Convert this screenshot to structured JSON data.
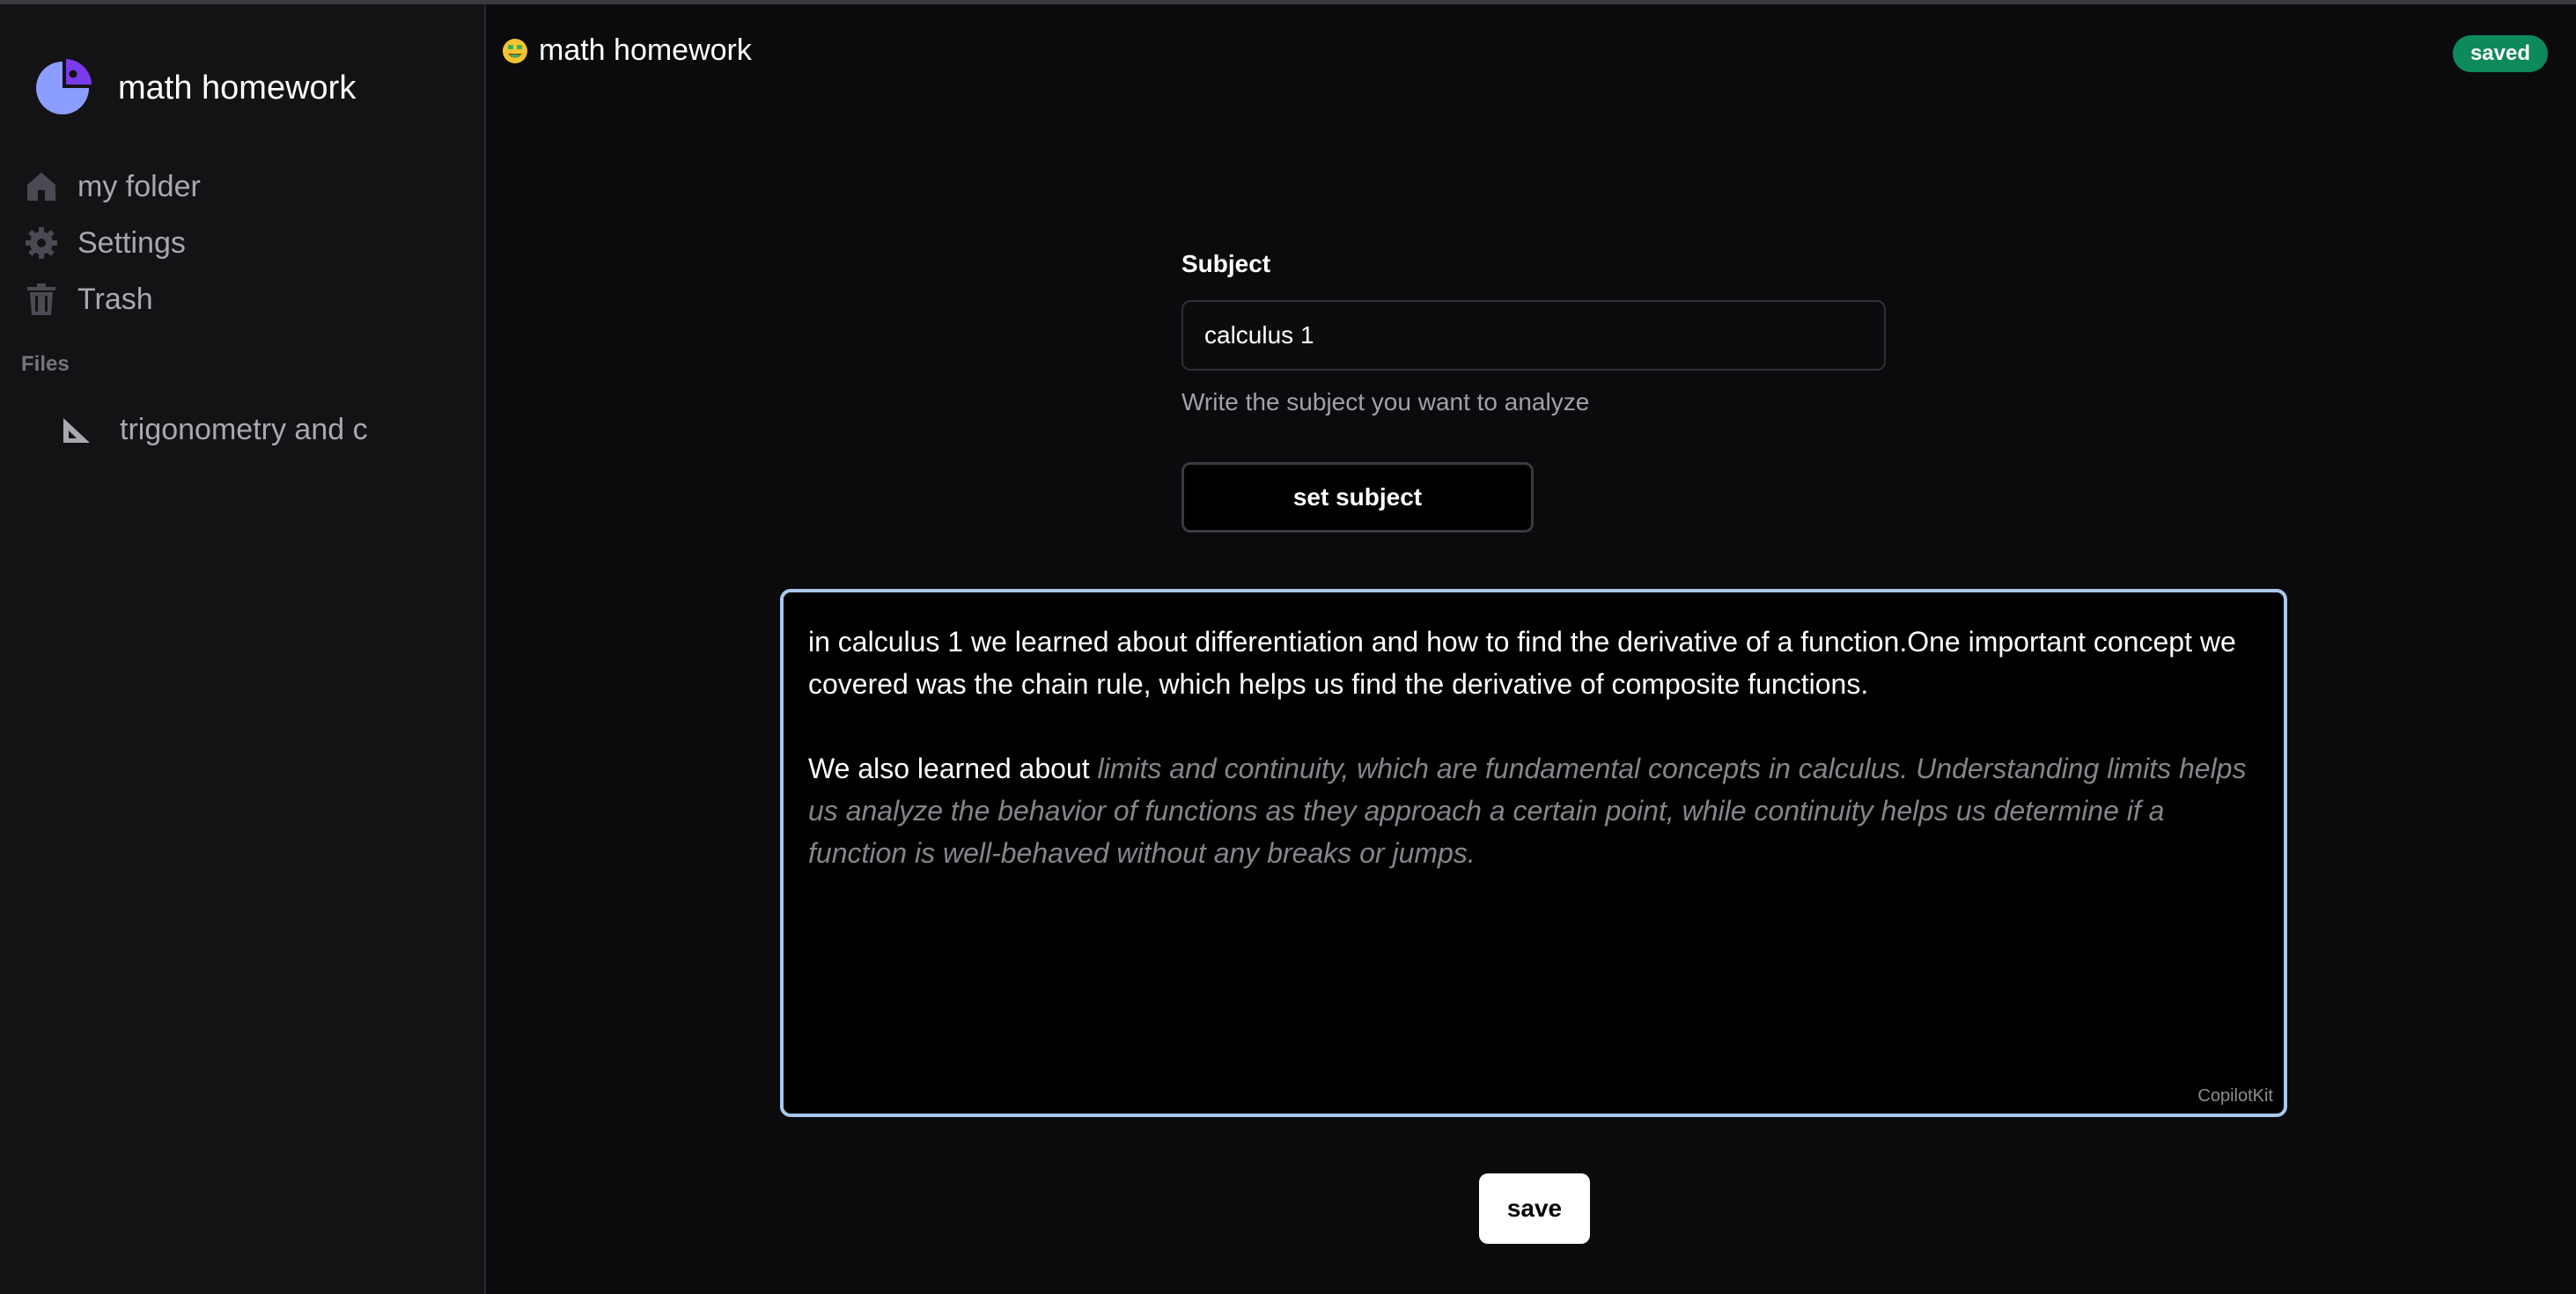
{
  "app": {
    "name": "math homework"
  },
  "sidebar": {
    "items": [
      {
        "label": "my folder",
        "icon": "home-icon"
      },
      {
        "label": "Settings",
        "icon": "gear-icon"
      },
      {
        "label": "Trash",
        "icon": "trash-icon"
      }
    ],
    "section_label": "Files",
    "files": [
      {
        "label": "trigonometry and c",
        "icon": "triangle-ruler-icon"
      }
    ]
  },
  "header": {
    "title": "math homework",
    "icon": "money-face-emoji-icon",
    "status": "saved",
    "status_color": "#0d8a5b"
  },
  "form": {
    "subject_label": "Subject",
    "subject_value": "calculus 1",
    "subject_hint": "Write the subject you want to analyze",
    "set_subject_label": "set subject"
  },
  "editor": {
    "paragraph_1": "in calculus 1 we learned about differentiation and how to find the derivative of a function.One important concept we covered was the chain rule, which helps us find the derivative of composite functions.",
    "paragraph_2_typed": "We also learned about ",
    "paragraph_2_suggestion": "limits and continuity, which are fundamental concepts in calculus. Understanding limits helps us analyze the behavior of functions as they approach a certain point, while continuity helps us determine if a function is well-behaved without any breaks or jumps.",
    "brand_tag": "CopilotKit",
    "focus_border_color": "#a9c8ea"
  },
  "actions": {
    "save_label": "save"
  },
  "colors": {
    "accent": "#7c3aed",
    "logo_blue": "#8b9dff"
  }
}
